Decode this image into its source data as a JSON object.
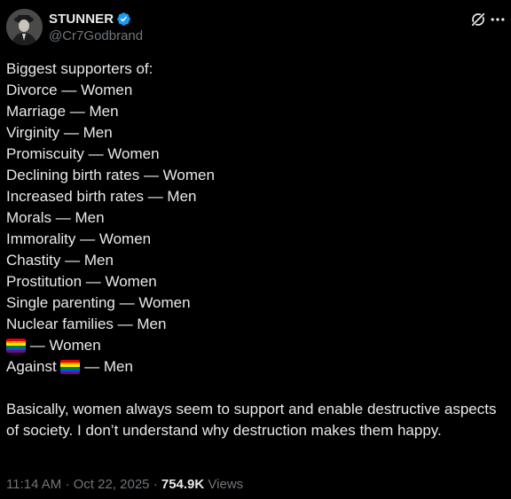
{
  "author": {
    "display_name": "STUNNER",
    "handle": "@Cr7Godbrand",
    "verified": true,
    "verified_color": "#1d9bf0"
  },
  "icons": {
    "avatar": "profile-photo",
    "grok": "grok-icon",
    "more": "more-icon"
  },
  "post": {
    "intro": "Biggest supporters of:",
    "lines": [
      {
        "text": "Divorce — Women"
      },
      {
        "text": "Marriage — Men"
      },
      {
        "text": "Virginity — Men"
      },
      {
        "text": "Promiscuity — Women"
      },
      {
        "text": "Declining birth rates — Women"
      },
      {
        "text": "Increased birth rates — Men"
      },
      {
        "text": "Morals — Men"
      },
      {
        "text": "Immorality — Women"
      },
      {
        "text": "Chastity — Men"
      },
      {
        "text": "Prostitution — Women"
      },
      {
        "text": "Single parenting — Women"
      },
      {
        "text": "Nuclear families — Men"
      },
      {
        "prefix": "",
        "emoji": "🏳️‍🌈",
        "suffix": " — Women"
      },
      {
        "prefix": "Against ",
        "emoji": "🏳️‍🌈",
        "suffix": " — Men"
      }
    ],
    "closing": "Basically, women always seem to support and enable destructive aspects of society. I don’t understand why destruction makes them happy."
  },
  "meta": {
    "time": "11:14 AM",
    "date": "Oct 22, 2025",
    "separator": "·",
    "views_count": "754.9K",
    "views_label": "Views"
  },
  "colors": {
    "background": "#000000",
    "text": "#e7e9ea",
    "secondary": "#71767b",
    "rainbow": [
      "#e40303",
      "#ff8c00",
      "#ffed00",
      "#008026",
      "#004dff",
      "#750787"
    ]
  }
}
